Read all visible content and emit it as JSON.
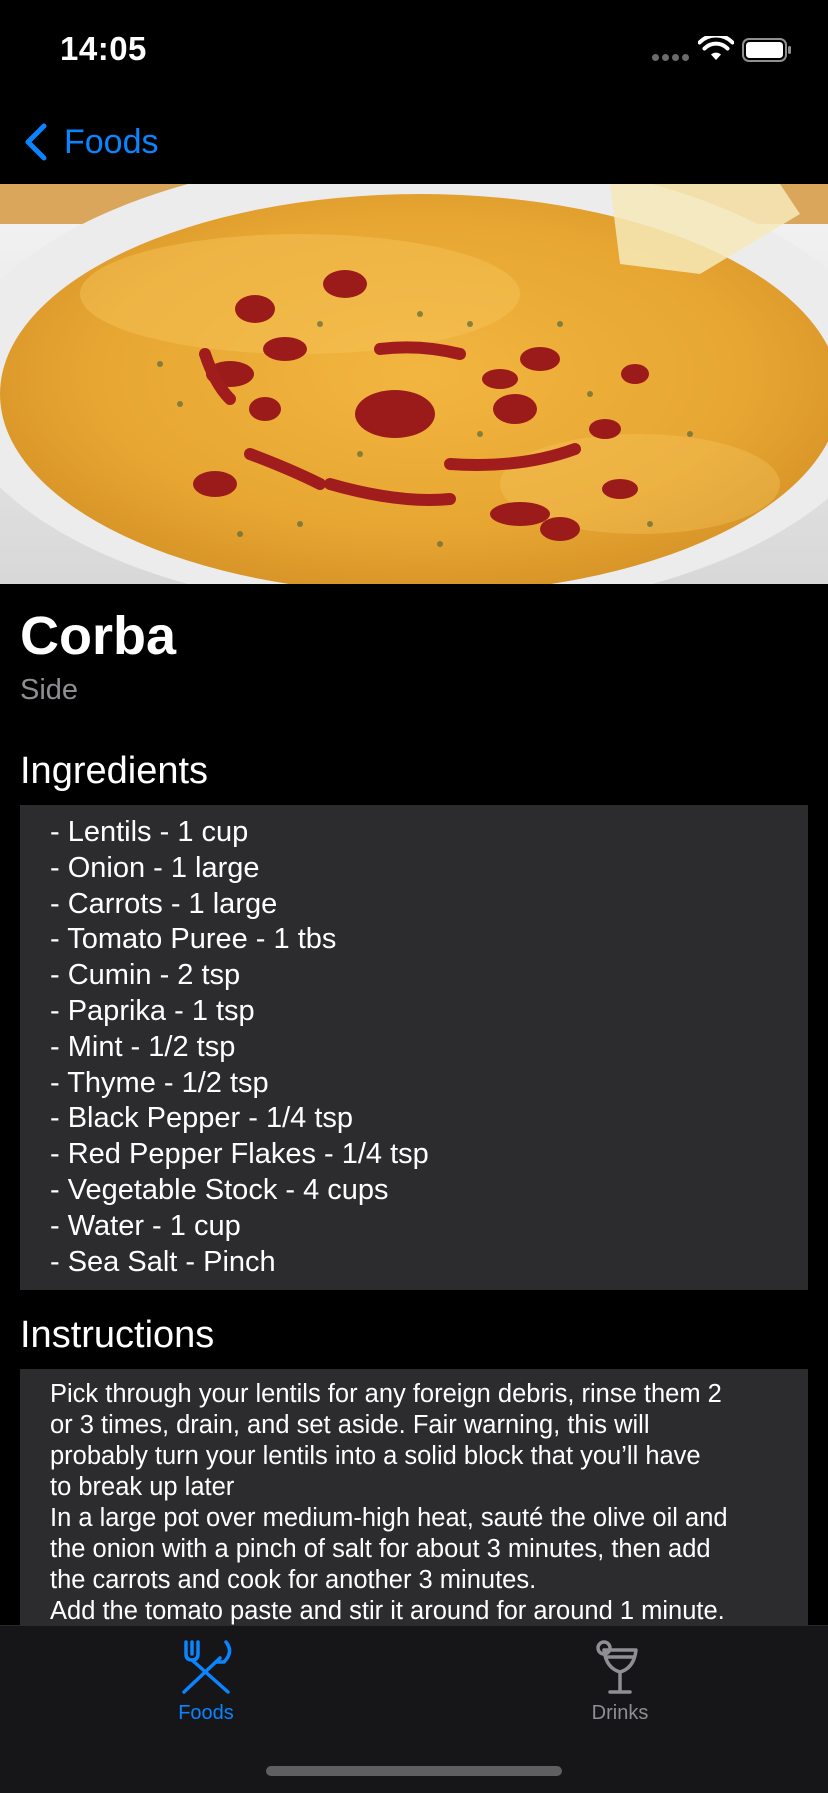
{
  "status_bar": {
    "time": "14:05"
  },
  "nav": {
    "back_label": "Foods"
  },
  "hero_image": {
    "description_icon": "soup-photo"
  },
  "meal": {
    "name": "Corba",
    "category": "Side"
  },
  "ingredients": {
    "title": "Ingredients",
    "items": [
      "- Lentils - 1 cup",
      "- Onion - 1 large",
      "- Carrots - 1 large",
      "- Tomato Puree - 1 tbs",
      "- Cumin - 2 tsp",
      "- Paprika - 1 tsp",
      "- Mint - 1/2 tsp",
      "- Thyme - 1/2 tsp",
      "- Black Pepper - 1/4 tsp",
      "- Red Pepper Flakes - 1/4 tsp",
      "- Vegetable Stock - 4 cups",
      "- Water - 1 cup",
      "- Sea Salt - Pinch"
    ]
  },
  "instructions": {
    "title": "Instructions",
    "lines": [
      "Pick through your lentils for any foreign debris, rinse them 2",
      "or 3 times, drain, and set aside.  Fair warning, this will",
      "probably turn your lentils into a solid block that you’ll have",
      "to break up later",
      "In a large pot over medium-high heat, sauté the olive oil and",
      "the onion with a pinch of salt for about 3 minutes, then add",
      "the carrots and cook for another 3 minutes.",
      "Add the tomato paste and stir it around for around 1 minute."
    ]
  },
  "tab_bar": {
    "tabs": [
      {
        "label": "Foods",
        "icon": "fork-knife-icon",
        "selected": true
      },
      {
        "label": "Drinks",
        "icon": "cocktail-glass-icon",
        "selected": false
      }
    ]
  },
  "colors": {
    "accent": "#0a84ff",
    "background": "#000000",
    "panel": "#2c2c2e",
    "secondary_text": "#8e8e93",
    "tab_bar": "#161618"
  }
}
